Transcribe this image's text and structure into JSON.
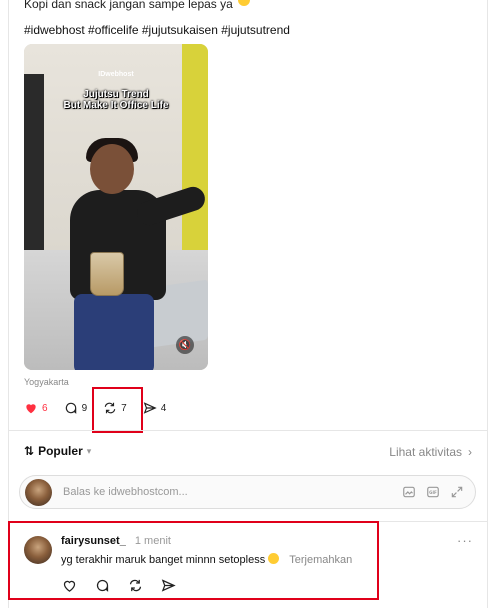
{
  "post": {
    "caption_partial": "Kopi dan snack jangan sampe lepas ya",
    "hashtags": "#idwebhost #officelife #jujutsukaisen #jujutsutrend",
    "media": {
      "brand": "IDwebhost",
      "overlay_line1": "Jujutsu Trend",
      "overlay_line2": "But Make It Office Life",
      "mute_icon": "speaker-muted-icon"
    },
    "location": "Yogyakarta",
    "stats": {
      "likes": "6",
      "comments": "9",
      "reposts": "7",
      "shares": "4"
    },
    "like_color": "#ff3040"
  },
  "replies_header": {
    "sort_label": "Populer",
    "activity_label": "Lihat aktivitas"
  },
  "reply_box": {
    "placeholder": "Balas ke idwebhostcom..."
  },
  "comment": {
    "username": "fairysunset_",
    "time": "1 menit",
    "text": "yg terakhir maruk banget minnn setopless",
    "translate_label": "Terjemahkan",
    "more_label": "···"
  },
  "highlight_color": "#e0001a"
}
